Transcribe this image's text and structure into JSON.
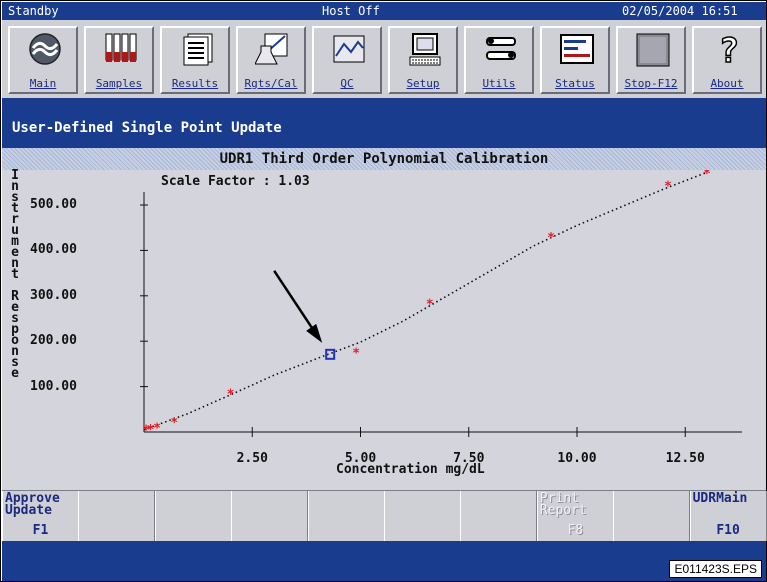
{
  "status_bar": {
    "left": "Standby",
    "center": "Host Off",
    "datetime": "02/05/2004 16:51"
  },
  "toolbar": {
    "buttons": [
      {
        "label": "Main",
        "icon": "main-icon"
      },
      {
        "label": "Samples",
        "icon": "samples-icon"
      },
      {
        "label": "Results",
        "icon": "results-icon"
      },
      {
        "label": "Rgts/Cal",
        "icon": "reagents-calibration-icon"
      },
      {
        "label": "QC",
        "icon": "qc-icon"
      },
      {
        "label": "Setup",
        "icon": "setup-icon"
      },
      {
        "label": "Utils",
        "icon": "utils-icon"
      },
      {
        "label": "Status",
        "icon": "status-icon"
      },
      {
        "label": "Stop-F12",
        "icon": "stop-icon"
      },
      {
        "label": "About",
        "icon": "about-icon"
      }
    ]
  },
  "screen": {
    "title": "User-Defined Single Point Update",
    "subtitle": "UDR1 Third Order Polynomial Calibration",
    "scale_label": "Scale Factor",
    "scale_value": "1.03"
  },
  "chart_data": {
    "type": "scatter",
    "ylabel": "Instrument Response",
    "xlabel": "Concentration mg/dL",
    "x_ticks": [
      "2.50",
      "5.00",
      "7.50",
      "10.00",
      "12.50"
    ],
    "y_ticks": [
      "100.00",
      "200.00",
      "300.00",
      "400.00",
      "500.00"
    ],
    "xlim": [
      0,
      13.1
    ],
    "ylim": [
      0,
      575
    ],
    "points": [
      {
        "x": 0.05,
        "y": 5
      },
      {
        "x": 0.15,
        "y": 7
      },
      {
        "x": 0.3,
        "y": 10
      },
      {
        "x": 0.7,
        "y": 22
      },
      {
        "x": 2.0,
        "y": 85
      },
      {
        "x": 4.9,
        "y": 175
      },
      {
        "x": 6.6,
        "y": 283
      },
      {
        "x": 9.4,
        "y": 430
      },
      {
        "x": 12.1,
        "y": 543
      },
      {
        "x": 13.0,
        "y": 570
      }
    ],
    "highlighted_point": {
      "x": 4.3,
      "y": 170
    },
    "fit_curve": [
      [
        0,
        5
      ],
      [
        1,
        40
      ],
      [
        2,
        82
      ],
      [
        3,
        125
      ],
      [
        4,
        162
      ],
      [
        5,
        198
      ],
      [
        6,
        245
      ],
      [
        7,
        300
      ],
      [
        8,
        355
      ],
      [
        9,
        410
      ],
      [
        10,
        455
      ],
      [
        11,
        495
      ],
      [
        12,
        535
      ],
      [
        13,
        572
      ]
    ],
    "colors": {
      "point": "#e0202a",
      "highlight": "#2230c0",
      "curve": "#111111"
    }
  },
  "function_keys": [
    {
      "text": "Approve\nUpdate",
      "key": "F1",
      "enabled": true
    },
    {
      "text": "",
      "key": "",
      "enabled": false
    },
    {
      "text": "",
      "key": "",
      "enabled": false
    },
    {
      "text": "",
      "key": "",
      "enabled": false
    },
    {
      "text": "",
      "key": "",
      "enabled": false
    },
    {
      "text": "",
      "key": "",
      "enabled": false
    },
    {
      "text": "",
      "key": "",
      "enabled": false
    },
    {
      "text": "Print\nReport",
      "key": "F8",
      "enabled": false
    },
    {
      "text": "",
      "key": "",
      "enabled": false
    },
    {
      "text": "UDRMain",
      "key": "F10",
      "enabled": true
    }
  ],
  "figure_id": "E011423S.EPS"
}
